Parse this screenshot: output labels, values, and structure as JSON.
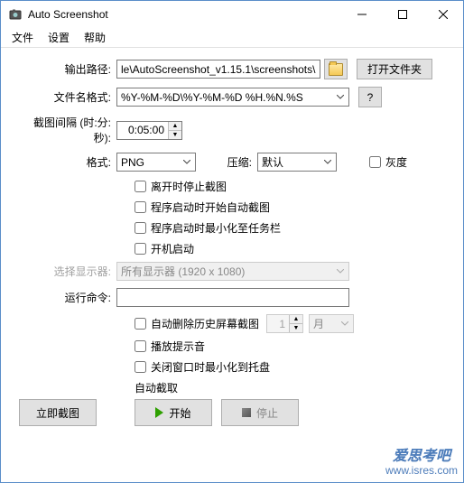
{
  "window": {
    "title": "Auto Screenshot"
  },
  "menu": {
    "file": "文件",
    "settings": "设置",
    "help": "帮助"
  },
  "labels": {
    "output_path": "输出路径:",
    "filename_format": "文件名格式:",
    "interval": "截图间隔 (时:分:秒):",
    "format": "格式:",
    "compress": "压缩:",
    "grayscale": "灰度",
    "select_display": "选择显示器:",
    "run_command": "运行命令:",
    "auto_capture": "自动截取"
  },
  "values": {
    "output_path": "le\\AutoScreenshot_v1.15.1\\screenshots\\",
    "filename_format": "%Y-%M-%D\\%Y-%M-%D %H.%N.%S",
    "interval": "0:05:00",
    "format": "PNG",
    "compress": "默认",
    "display": "所有显示器 (1920 x 1080)",
    "run_command": "",
    "history_count": "1",
    "history_unit": "月"
  },
  "checkboxes": {
    "stop_on_leave": "离开时停止截图",
    "start_on_launch": "程序启动时开始自动截图",
    "minimize_on_launch": "程序启动时最小化至任务栏",
    "start_with_os": "开机启动",
    "auto_delete": "自动删除历史屏幕截图",
    "play_sound": "播放提示音",
    "minimize_to_tray": "关闭窗口时最小化到托盘"
  },
  "buttons": {
    "open_folder": "打开文件夹",
    "help": "?",
    "screenshot_now": "立即截图",
    "start": "开始",
    "stop": "停止"
  },
  "watermark": {
    "line1": "爱思考吧",
    "line2": "www.isres.com"
  }
}
